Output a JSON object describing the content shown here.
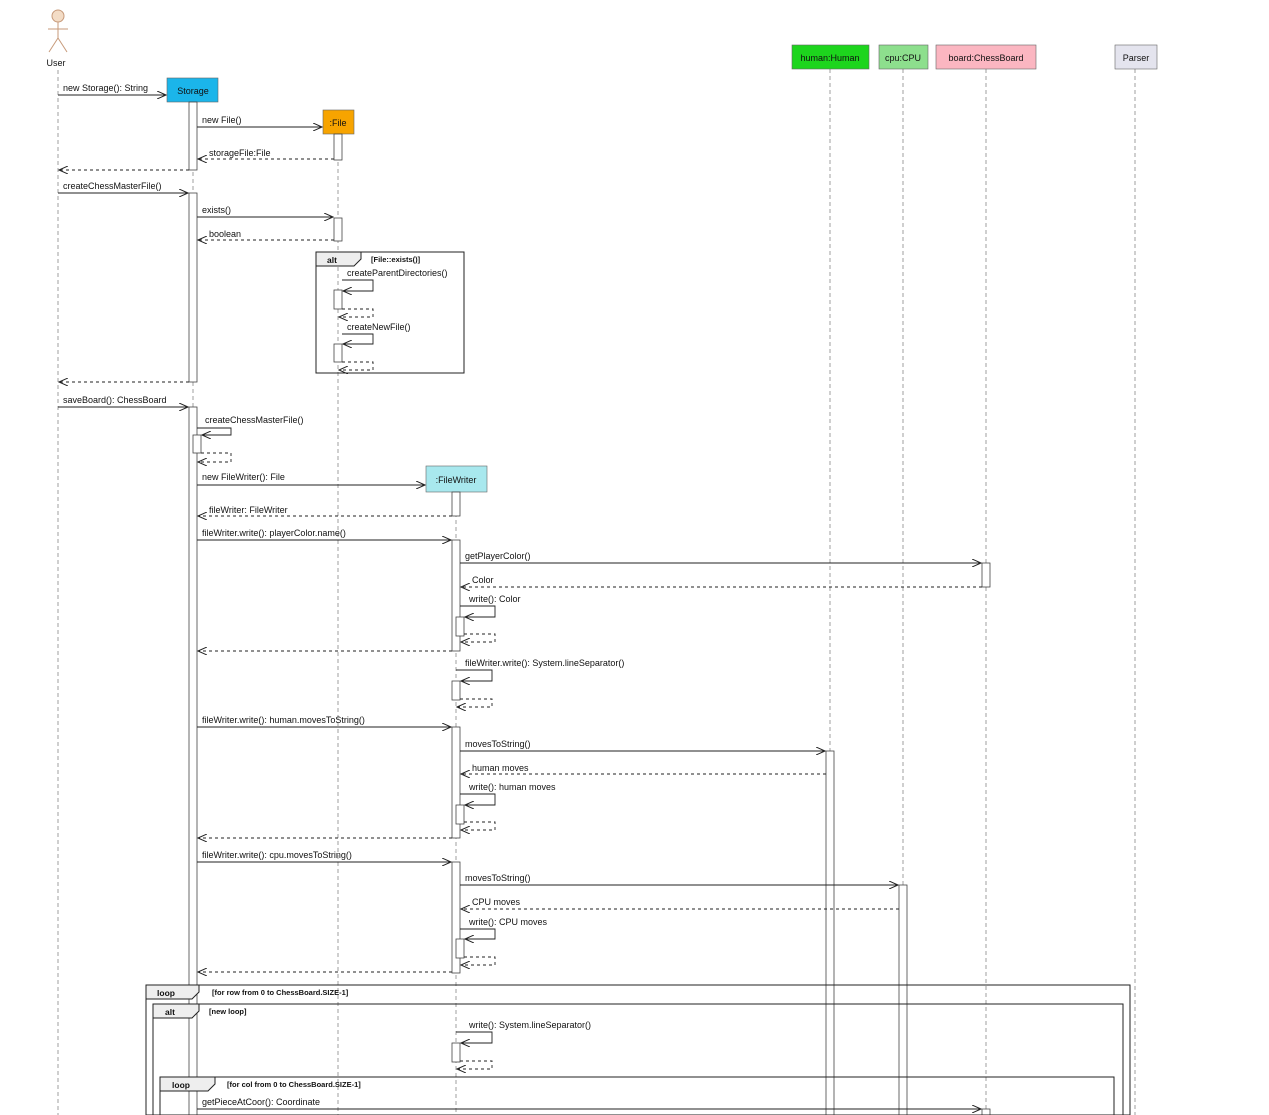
{
  "actor": {
    "label": "User"
  },
  "participants": [
    {
      "id": "storage",
      "label": "Storage",
      "color": "#1bb5ea"
    },
    {
      "id": "file",
      "label": ":File",
      "color": "#f7a400"
    },
    {
      "id": "filewriter",
      "label": ":FileWriter",
      "color": "#a8e8ee"
    },
    {
      "id": "human",
      "label": "human:Human",
      "color": "#1dd51d"
    },
    {
      "id": "cpu",
      "label": "cpu:CPU",
      "color": "#8ddf8d"
    },
    {
      "id": "board",
      "label": "board:ChessBoard",
      "color": "#fbb6c1"
    },
    {
      "id": "parser",
      "label": "Parser",
      "color": "#e4e4ee"
    }
  ],
  "messages": [
    {
      "id": "m1",
      "text": "new Storage(): String"
    },
    {
      "id": "m2",
      "text": "new File()"
    },
    {
      "id": "m3",
      "text": "storageFile:File"
    },
    {
      "id": "m4",
      "text": ""
    },
    {
      "id": "m5",
      "text": "createChessMasterFile()"
    },
    {
      "id": "m6",
      "text": "exists()"
    },
    {
      "id": "m7",
      "text": "boolean"
    },
    {
      "id": "m8",
      "text": "createParentDirectories()"
    },
    {
      "id": "m9",
      "text": "createNewFile()"
    },
    {
      "id": "m10",
      "text": ""
    },
    {
      "id": "m11",
      "text": "saveBoard(): ChessBoard"
    },
    {
      "id": "m12",
      "text": "createChessMasterFile()"
    },
    {
      "id": "m13",
      "text": "new FileWriter(): File"
    },
    {
      "id": "m14",
      "text": "fileWriter: FileWriter"
    },
    {
      "id": "m15",
      "text": "fileWriter.write(): playerColor.name()"
    },
    {
      "id": "m16",
      "text": "getPlayerColor()"
    },
    {
      "id": "m17",
      "text": "Color"
    },
    {
      "id": "m18",
      "text": "write(): Color"
    },
    {
      "id": "m19",
      "text": ""
    },
    {
      "id": "m20",
      "text": "fileWriter.write(): System.lineSeparator()"
    },
    {
      "id": "m21",
      "text": "fileWriter.write(): human.movesToString()"
    },
    {
      "id": "m22",
      "text": "movesToString()"
    },
    {
      "id": "m23",
      "text": "human moves"
    },
    {
      "id": "m24",
      "text": "write(): human moves"
    },
    {
      "id": "m25",
      "text": ""
    },
    {
      "id": "m26",
      "text": "fileWriter.write(): cpu.movesToString()"
    },
    {
      "id": "m27",
      "text": "movesToString()"
    },
    {
      "id": "m28",
      "text": "CPU moves"
    },
    {
      "id": "m29",
      "text": "write(): CPU moves"
    },
    {
      "id": "m30",
      "text": ""
    },
    {
      "id": "m31",
      "text": "write(): System.lineSeparator()"
    },
    {
      "id": "m32",
      "text": "getPieceAtCoor(): Coordinate"
    }
  ],
  "frames": [
    {
      "id": "f1",
      "tag": "alt",
      "guard": "[File::exists()]"
    },
    {
      "id": "f2",
      "tag": "loop",
      "guard": "[for row from 0 to ChessBoard.SIZE-1]"
    },
    {
      "id": "f3",
      "tag": "alt",
      "guard": "[new loop]"
    },
    {
      "id": "f4",
      "tag": "loop",
      "guard": "[for col from 0 to ChessBoard.SIZE-1]"
    }
  ]
}
